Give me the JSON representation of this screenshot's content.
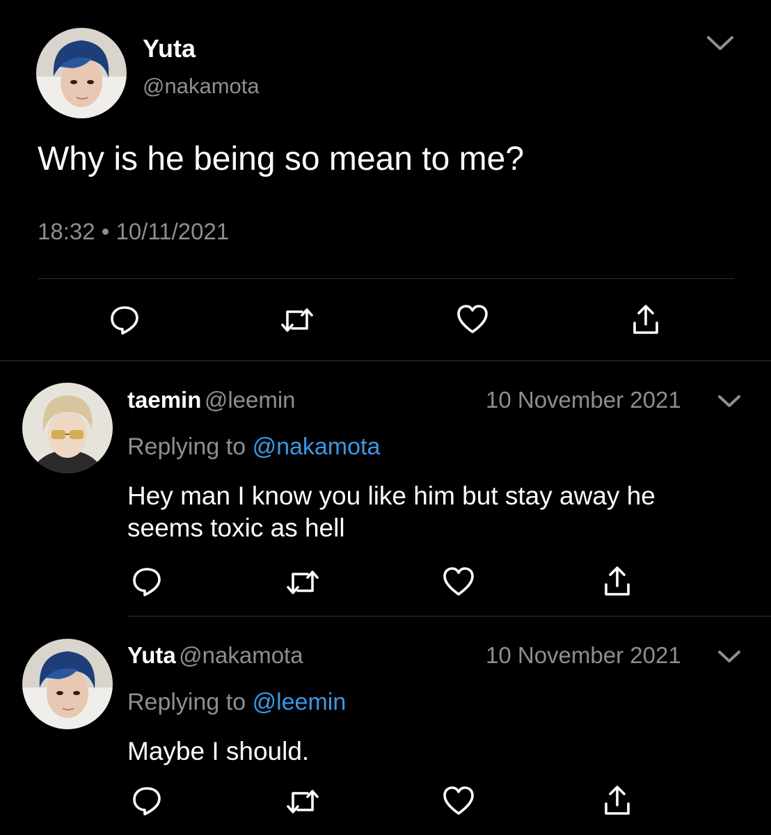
{
  "main_tweet": {
    "name": "Yuta",
    "handle": "@nakamota",
    "text": "Why is he being so mean to me?",
    "timestamp": "18:32 • 10/11/2021"
  },
  "replies": [
    {
      "name": "taemin",
      "handle": "@leemin",
      "date": "10 November 2021",
      "replying_prefix": "Replying to",
      "replying_to": "@nakamota",
      "text_lines": [
        "Hey man I know you like him but stay away he",
        "seems toxic as hell"
      ]
    },
    {
      "name": "Yuta",
      "handle": "@nakamota",
      "date": "10 November 2021",
      "replying_prefix": "Replying to",
      "replying_to": "@leemin",
      "text_lines": [
        "Maybe I should."
      ]
    }
  ],
  "icons": {
    "reply": "reply-icon",
    "retweet": "retweet-icon",
    "like": "heart-icon",
    "share": "share-icon",
    "more": "chevron-down-icon"
  },
  "colors": {
    "background": "#000000",
    "secondary_text": "#8e8e93",
    "link": "#3a98e6",
    "icon": "#ffffff",
    "divider": "#2f3336"
  }
}
